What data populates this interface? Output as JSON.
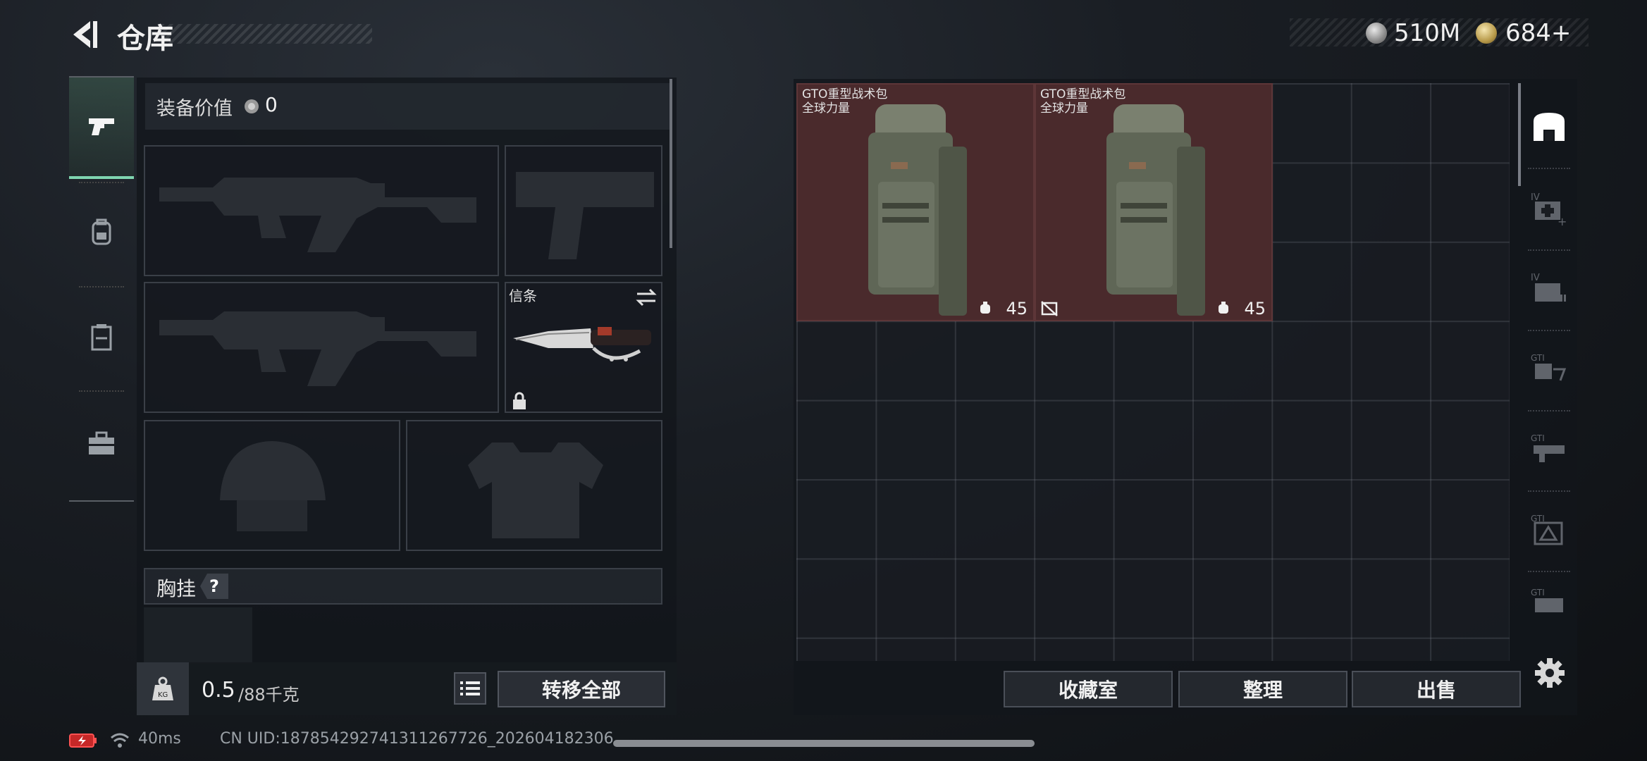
{
  "header": {
    "title": "仓库",
    "back_icon": "back-arrow-icon",
    "currency": {
      "silver_amount": "510M",
      "silver_icon": "silver-coin-icon",
      "gold_amount": "684",
      "gold_plus": "+",
      "gold_icon": "gold-coin-icon"
    }
  },
  "left_tabs": [
    {
      "icon": "pistol-icon",
      "active": true
    },
    {
      "icon": "backpack-icon",
      "active": false
    },
    {
      "icon": "clipboard-icon",
      "active": false
    },
    {
      "icon": "toolbox-icon",
      "active": false
    }
  ],
  "equipment": {
    "value_label": "装备价值",
    "value_amount": "0",
    "melee_label": "信条",
    "chest_label": "胸挂",
    "chest_help": "?"
  },
  "weight": {
    "current": "0.5",
    "max": "/88千克",
    "icon": "weight-icon"
  },
  "buttons": {
    "transfer_all": "转移全部",
    "collection": "收藏室",
    "organize": "整理",
    "sell": "出售"
  },
  "storage_items": [
    {
      "name_line1": "GTO重型战术包",
      "name_line2": "全球力量",
      "capacity": "45",
      "unslotted": false
    },
    {
      "name_line1": "GTO重型战术包",
      "name_line2": "全球力量",
      "capacity": "45",
      "unslotted": true
    }
  ],
  "filters": [
    {
      "icon": "backpack-category-icon",
      "active": true
    },
    {
      "icon": "medkit-category-icon",
      "active": false
    },
    {
      "icon": "ammo-category-icon",
      "active": false
    },
    {
      "icon": "gti-attachment-icon",
      "active": false
    },
    {
      "icon": "gti-weapon-icon",
      "active": false
    },
    {
      "icon": "gti-triangle-icon",
      "active": false
    },
    {
      "icon": "gti-misc-icon",
      "active": false
    }
  ],
  "status_bar": {
    "ping": "40ms",
    "uid": "CN UID:187854292741311267726_202604182306"
  },
  "colors": {
    "accent": "#7fd6b0",
    "item_bg": "#4a2a2c",
    "panel_bg": "#12161b"
  }
}
